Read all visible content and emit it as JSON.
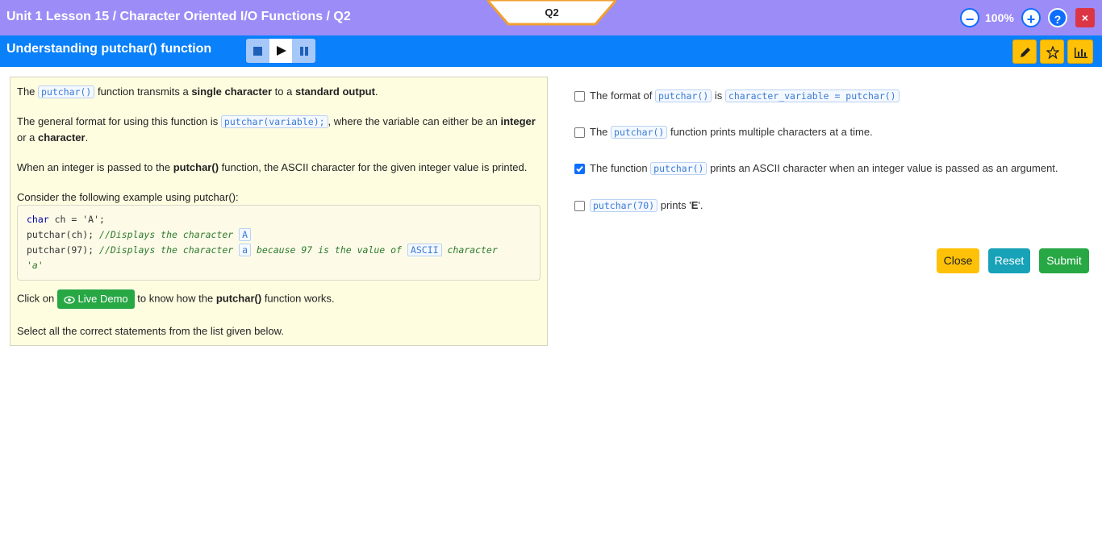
{
  "header": {
    "breadcrumb": "Unit 1 Lesson 15 / Character Oriented I/O Functions / Q2",
    "question_tab": "Q2",
    "zoom_level": "100%",
    "zoom_out_label": "−",
    "zoom_in_label": "+",
    "help_label": "?",
    "close_label": "×"
  },
  "subheader": {
    "title": "Understanding putchar() function"
  },
  "content": {
    "p1": {
      "a": "The",
      "code": "putchar()",
      "b": "function transmits a",
      "bold1": "single character",
      "c": "to a",
      "bold2": "standard output",
      "d": "."
    },
    "p2": {
      "a": "The general format for using this function is",
      "code": "putchar(variable);",
      "b": ", where the variable can either be an",
      "bold1": "integer",
      "c": "or a",
      "bold2": "character",
      "d": "."
    },
    "p3": {
      "a": "When an integer is passed to the",
      "bold1": "putchar()",
      "b": "function, the ASCII character for the given integer value is printed."
    },
    "p4": "Consider the following example using putchar():",
    "code": {
      "line1_kw": "char",
      "line1_rest": " ch = 'A';",
      "line2_code": "putchar(ch);  ",
      "line2_comment": "//Displays the character ",
      "line2_hl": "A",
      "line3_code": "putchar(97);  ",
      "line3_comment": "//Displays the character ",
      "line3_hl1": "a",
      "line3_mid": " because 97 is the value of ",
      "line3_hl2": "ASCII",
      "line3_end": " character",
      "line4": "'a'"
    },
    "p5": {
      "a": "Click on",
      "button": "Live Demo",
      "b": "to know how the",
      "bold1": "putchar()",
      "c": "function works."
    },
    "p6": "Select all the correct statements from the list given below."
  },
  "options": [
    {
      "a": "The format of",
      "code1": "putchar()",
      "b": "is",
      "code2": "character_variable = putchar()",
      "checked": false
    },
    {
      "a": "The",
      "code1": "putchar()",
      "b": "function prints multiple characters at a time.",
      "checked": false
    },
    {
      "a": "The function",
      "code1": "putchar()",
      "b": "prints an ASCII character when an integer value is passed as an argument.",
      "checked": true
    },
    {
      "code1": "putchar(70)",
      "b": "prints '",
      "bold": "E",
      "c": "'.",
      "checked": false
    }
  ],
  "actions": {
    "close": "Close",
    "reset": "Reset",
    "submit": "Submit"
  },
  "colors": {
    "topbar": "#9c8cf7",
    "subbar": "#0a80fb",
    "close_btn": "#ffc107",
    "reset_btn": "#17a2b8",
    "submit_btn": "#28a745"
  }
}
